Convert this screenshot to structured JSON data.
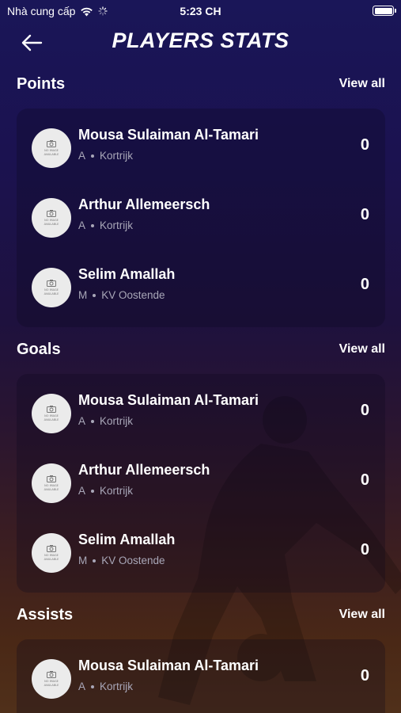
{
  "status_bar": {
    "carrier": "Nhà cung cấp",
    "time": "5:23 CH"
  },
  "header": {
    "title": "PLAYERS STATS",
    "back_icon": "arrow-left-icon"
  },
  "avatar_placeholder": {
    "line1": "NO IMAGE",
    "line2": "AVAILABLE"
  },
  "sections": [
    {
      "title": "Points",
      "view_all": "View all",
      "players": [
        {
          "name": "Mousa Sulaiman Al-Tamari",
          "position": "A",
          "team": "Kortrijk",
          "value": "0"
        },
        {
          "name": "Arthur Allemeersch",
          "position": "A",
          "team": "Kortrijk",
          "value": "0"
        },
        {
          "name": "Selim Amallah",
          "position": "M",
          "team": "KV Oostende",
          "value": "0"
        }
      ]
    },
    {
      "title": "Goals",
      "view_all": "View all",
      "players": [
        {
          "name": "Mousa Sulaiman Al-Tamari",
          "position": "A",
          "team": "Kortrijk",
          "value": "0"
        },
        {
          "name": "Arthur Allemeersch",
          "position": "A",
          "team": "Kortrijk",
          "value": "0"
        },
        {
          "name": "Selim Amallah",
          "position": "M",
          "team": "KV Oostende",
          "value": "0"
        }
      ]
    },
    {
      "title": "Assists",
      "view_all": "View all",
      "players": [
        {
          "name": "Mousa Sulaiman Al-Tamari",
          "position": "A",
          "team": "Kortrijk",
          "value": "0"
        }
      ]
    }
  ]
}
